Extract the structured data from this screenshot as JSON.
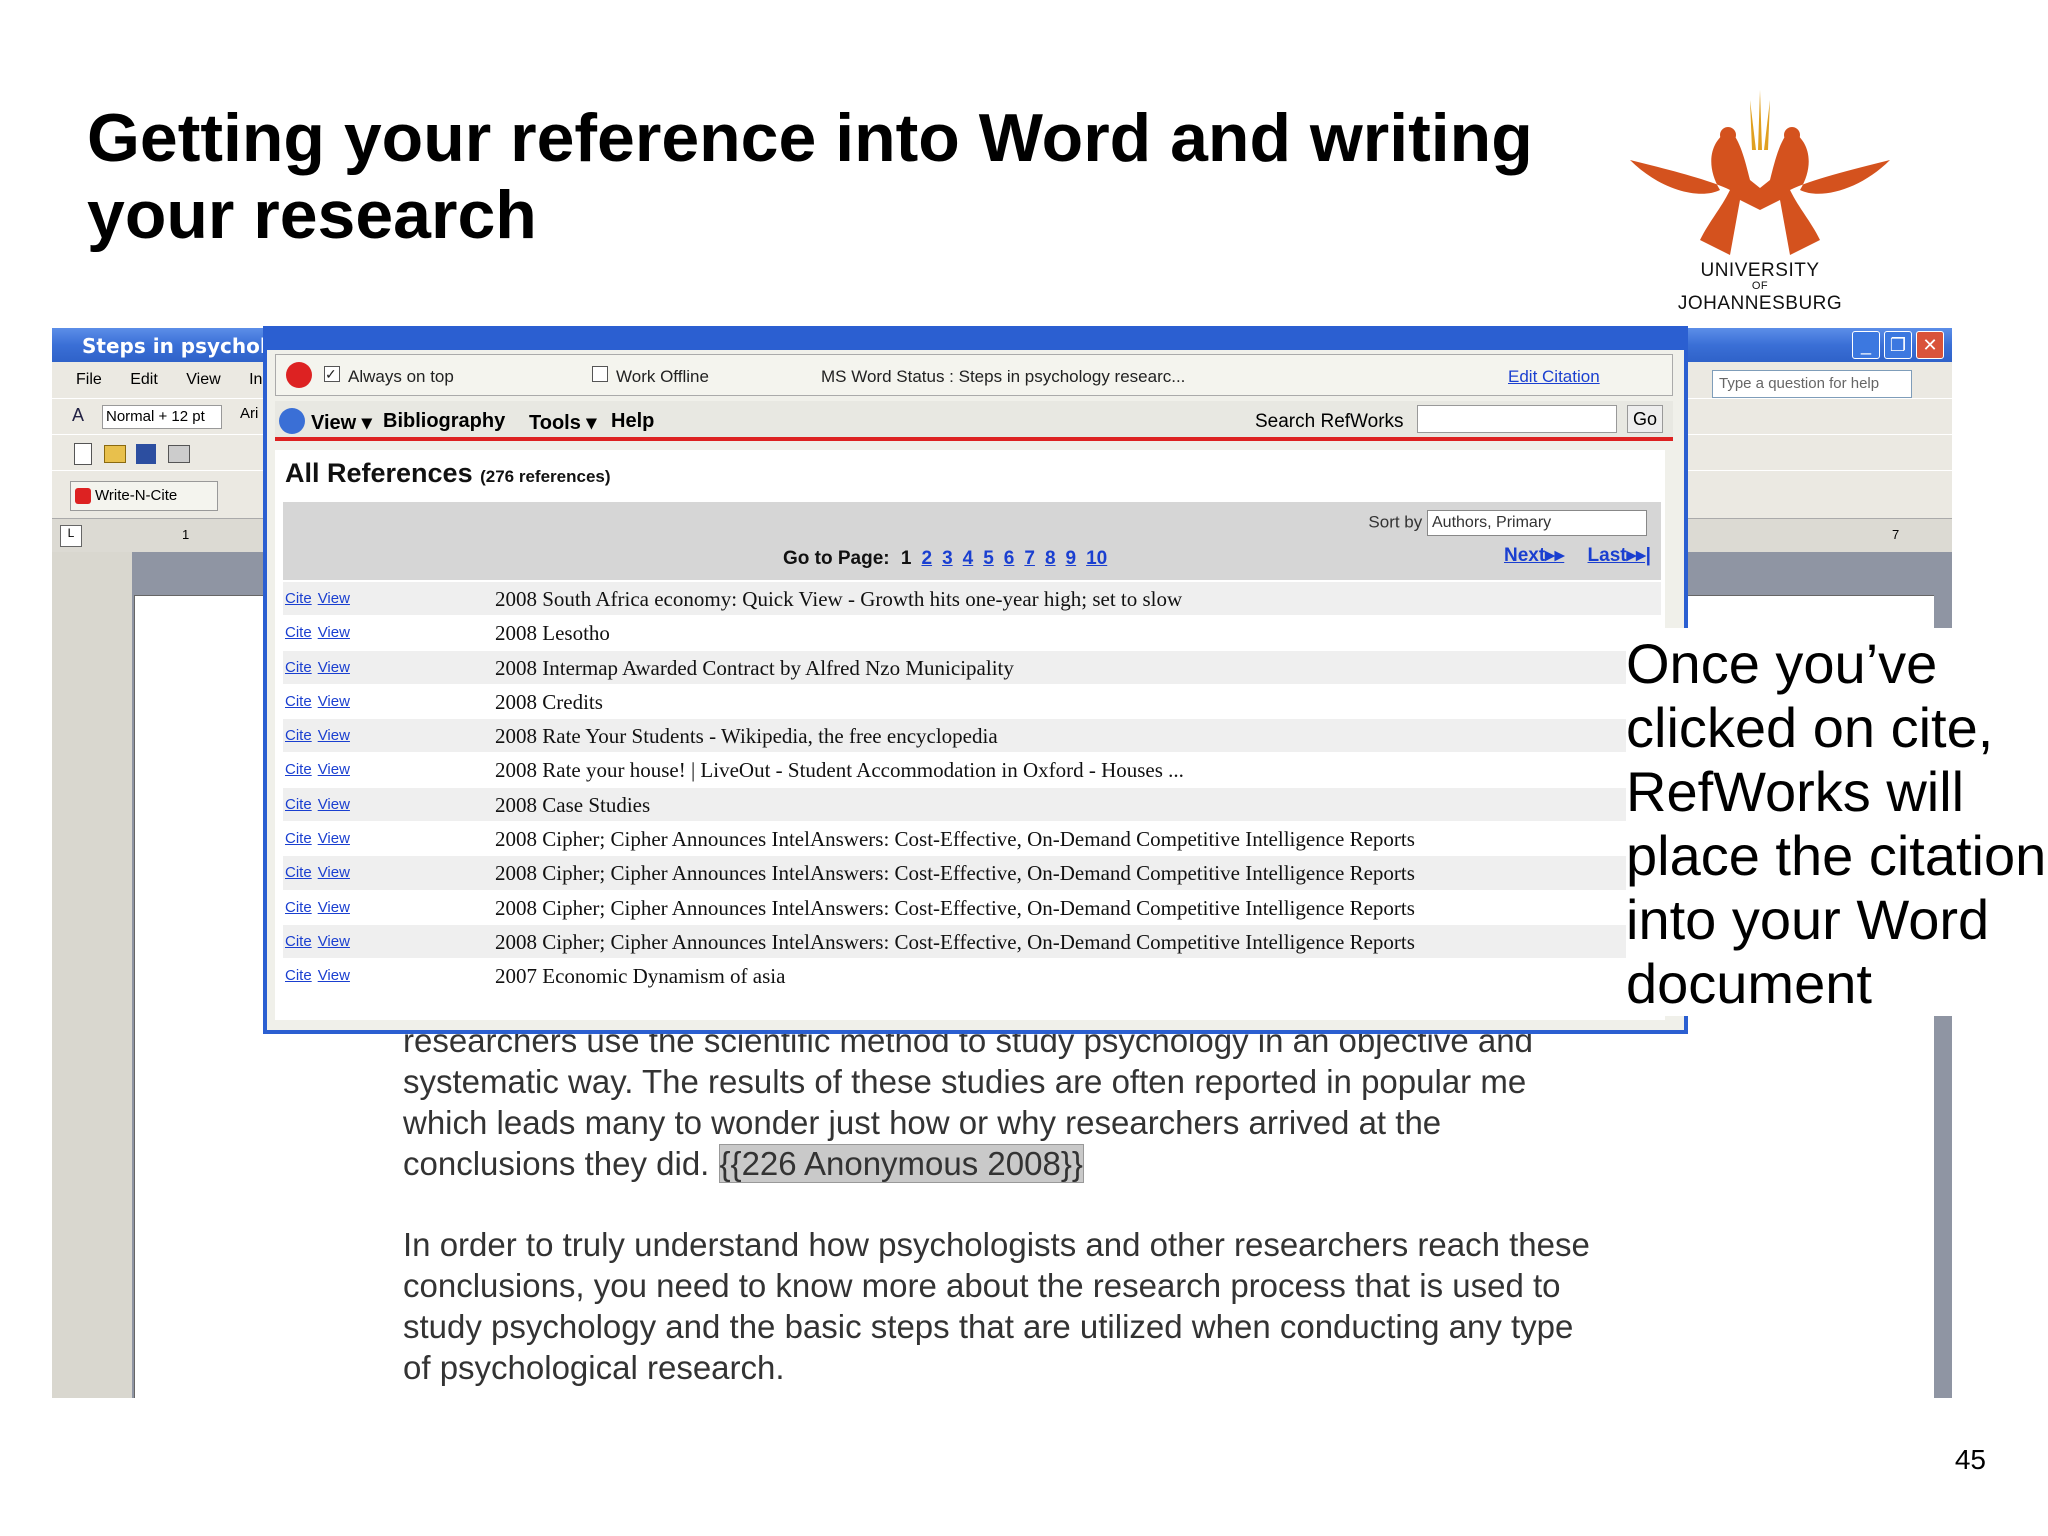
{
  "slide": {
    "title": "Getting your reference into Word and writing your research",
    "page_number": "45",
    "callout": "Once you’ve clicked on cite, RefWorks will place the citation into your Word document"
  },
  "logo": {
    "line1": "UNIVERSITY",
    "line2": "OF",
    "line3": "JOHANNESBURG",
    "color": "#d4521e"
  },
  "word": {
    "title": "Steps in psychology",
    "menu": [
      "File",
      "Edit",
      "View",
      "Inse"
    ],
    "style_box": "Normal + 12 pt",
    "font_box": "Ari",
    "writencite_button": "Write-N-Cite",
    "help_placeholder": "Type a question for help",
    "ruler_left": "1",
    "ruler_right": "7",
    "doc_lines": [
      "researchers use the scientific method to study psychology in an objective and",
      "systematic way. The results of these studies are often reported in popular me",
      "which leads many to wonder just how or why researchers arrived at the",
      "conclusions they did."
    ],
    "citation": "{{226 Anonymous 2008}}",
    "doc_para2": [
      "In order to truly understand how psychologists and other researchers reach these",
      "conclusions, you need to know more about the research process that is used to",
      "study psychology and the basic steps that are utilized when conducting any type",
      "of psychological research."
    ]
  },
  "wnc": {
    "always_on_top": "Always on top",
    "work_offline": "Work Offline",
    "status": "MS Word Status : Steps in psychology researc...",
    "edit_citation": "Edit Citation",
    "menu_view": "View",
    "menu_bibliography": "Bibliography",
    "menu_tools": "Tools",
    "menu_help": "Help",
    "search_label": "Search RefWorks",
    "go": "Go",
    "heading": "All References",
    "count": "(276 references)",
    "sort_label": "Sort by",
    "sort_value": "Authors, Primary",
    "goto_label": "Go to Page:",
    "pages": [
      "1",
      "2",
      "3",
      "4",
      "5",
      "6",
      "7",
      "8",
      "9",
      "10"
    ],
    "next": "Next",
    "last": "Last",
    "cite": "Cite",
    "view": "View",
    "references": [
      "2008 South Africa economy: Quick View - Growth hits one-year high; set to slow",
      "2008 Lesotho",
      "2008 Intermap Awarded Contract by Alfred Nzo Municipality",
      "2008 Credits",
      "2008 Rate Your Students - Wikipedia, the free encyclopedia",
      "2008 Rate your house! | LiveOut - Student Accommodation in Oxford - Houses ...",
      "2008 Case Studies",
      "2008 Cipher; Cipher Announces IntelAnswers: Cost-Effective, On-Demand Competitive Intelligence Reports",
      "2008 Cipher; Cipher Announces IntelAnswers: Cost-Effective, On-Demand Competitive Intelligence Reports",
      "2008 Cipher; Cipher Announces IntelAnswers: Cost-Effective, On-Demand Competitive Intelligence Reports",
      "2008 Cipher; Cipher Announces IntelAnswers: Cost-Effective, On-Demand Competitive Intelligence Reports",
      "2007 Economic Dynamism of asia"
    ]
  }
}
